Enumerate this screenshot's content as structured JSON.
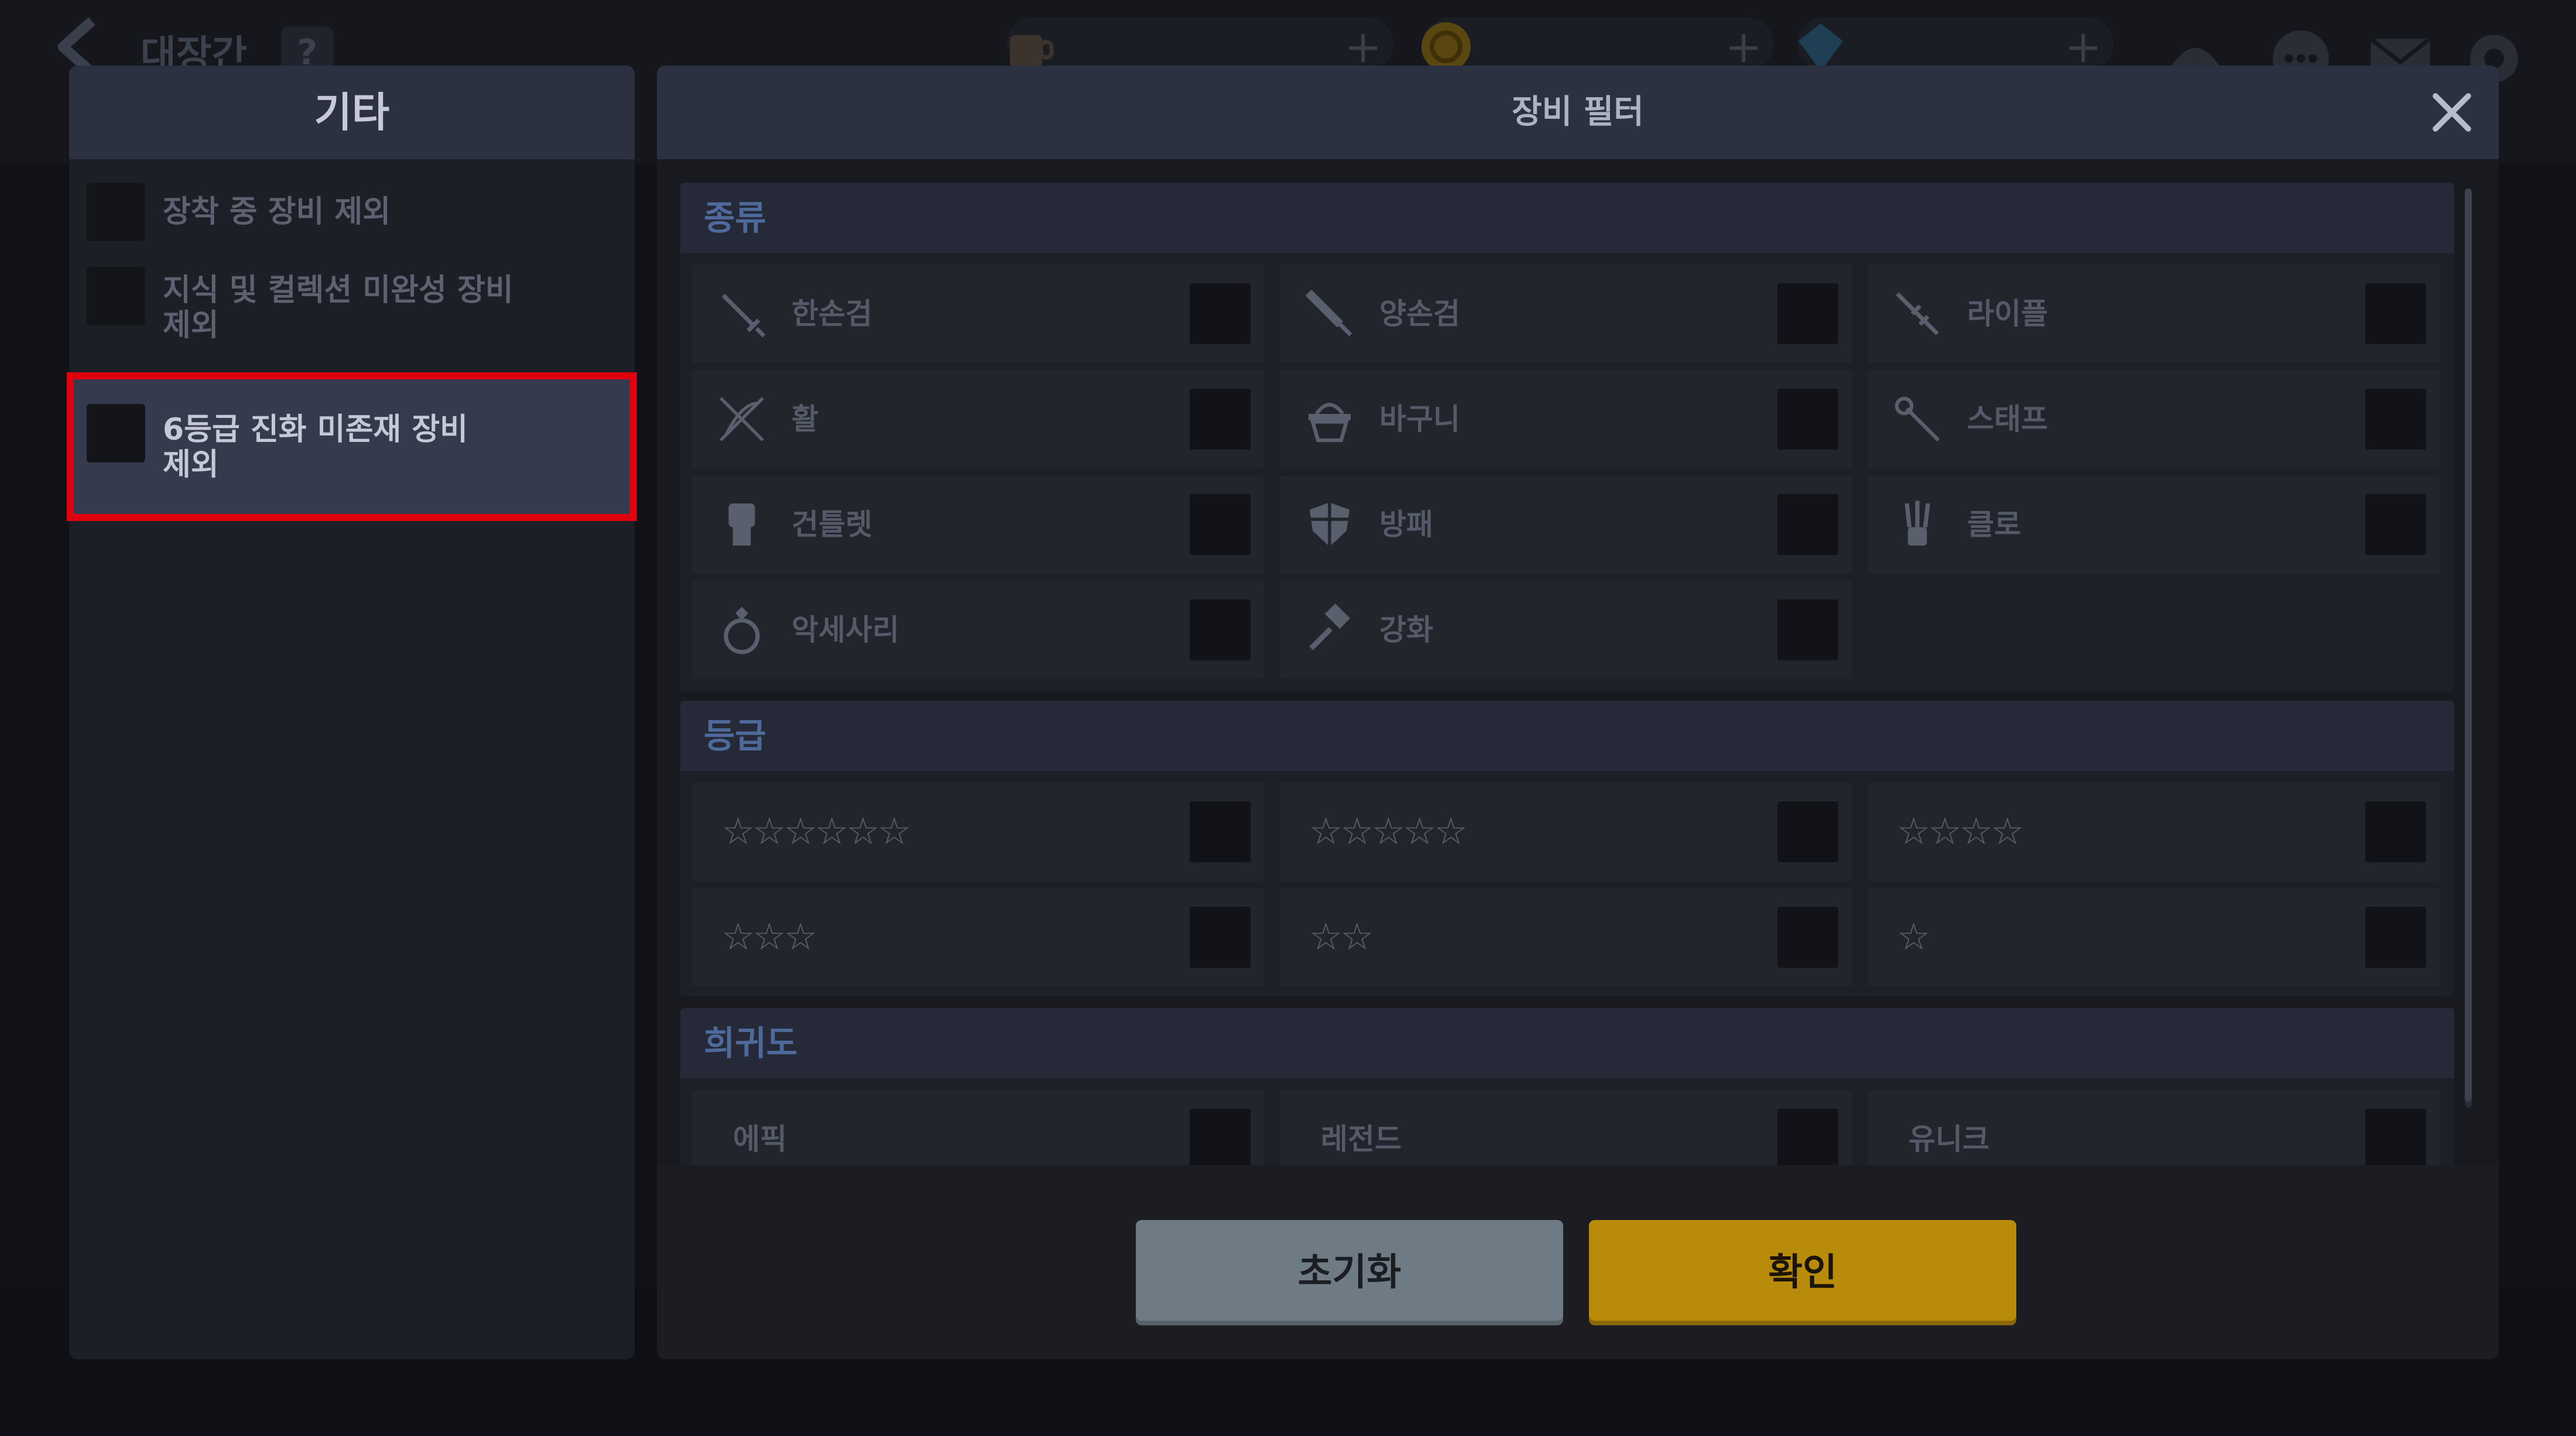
{
  "topbar": {
    "scene_title": "대장간",
    "help_label": "?",
    "currencies": [
      {
        "icon": "coffee-icon",
        "plus": "+"
      },
      {
        "icon": "gold-coin-icon",
        "plus": "+"
      },
      {
        "icon": "gem-icon",
        "plus": "+"
      }
    ]
  },
  "left_panel": {
    "title": "기타",
    "options": [
      {
        "label_lines": [
          "장착 중 장비 제외"
        ],
        "checked": false
      },
      {
        "label_lines": [
          "지식 및 컬렉션 미완성 장비",
          "제외"
        ],
        "checked": false
      },
      {
        "label_lines": [
          "6등급 진화 미존재 장비",
          "제외"
        ],
        "checked": false,
        "selected": true
      }
    ]
  },
  "filter": {
    "title": "장비 필터",
    "close_icon": "close-icon",
    "sections": {
      "type": {
        "title": "종류",
        "items": [
          {
            "label": "한손검",
            "icon": "one-handed-sword-icon"
          },
          {
            "label": "양손검",
            "icon": "two-handed-sword-icon"
          },
          {
            "label": "라이플",
            "icon": "rifle-icon"
          },
          {
            "label": "활",
            "icon": "bow-icon"
          },
          {
            "label": "바구니",
            "icon": "basket-icon"
          },
          {
            "label": "스태프",
            "icon": "staff-icon"
          },
          {
            "label": "건틀렛",
            "icon": "gauntlet-icon"
          },
          {
            "label": "방패",
            "icon": "shield-icon"
          },
          {
            "label": "클로",
            "icon": "claw-icon"
          },
          {
            "label": "악세사리",
            "icon": "ring-icon"
          },
          {
            "label": "강화",
            "icon": "hammer-icon"
          }
        ]
      },
      "grade": {
        "title": "등급",
        "items": [
          {
            "stars": "☆☆☆☆☆☆"
          },
          {
            "stars": "☆☆☆☆☆"
          },
          {
            "stars": "☆☆☆☆"
          },
          {
            "stars": "☆☆☆"
          },
          {
            "stars": "☆☆"
          },
          {
            "stars": "☆"
          }
        ]
      },
      "rarity": {
        "title": "희귀도",
        "items": [
          {
            "label": "에픽"
          },
          {
            "label": "레전드"
          },
          {
            "label": "유니크"
          }
        ]
      }
    },
    "buttons": {
      "reset": "초기화",
      "confirm": "확인"
    }
  },
  "colors": {
    "highlight": "#e0000e",
    "confirm_button": "#b88b0a",
    "reset_button": "#6f7b84"
  }
}
